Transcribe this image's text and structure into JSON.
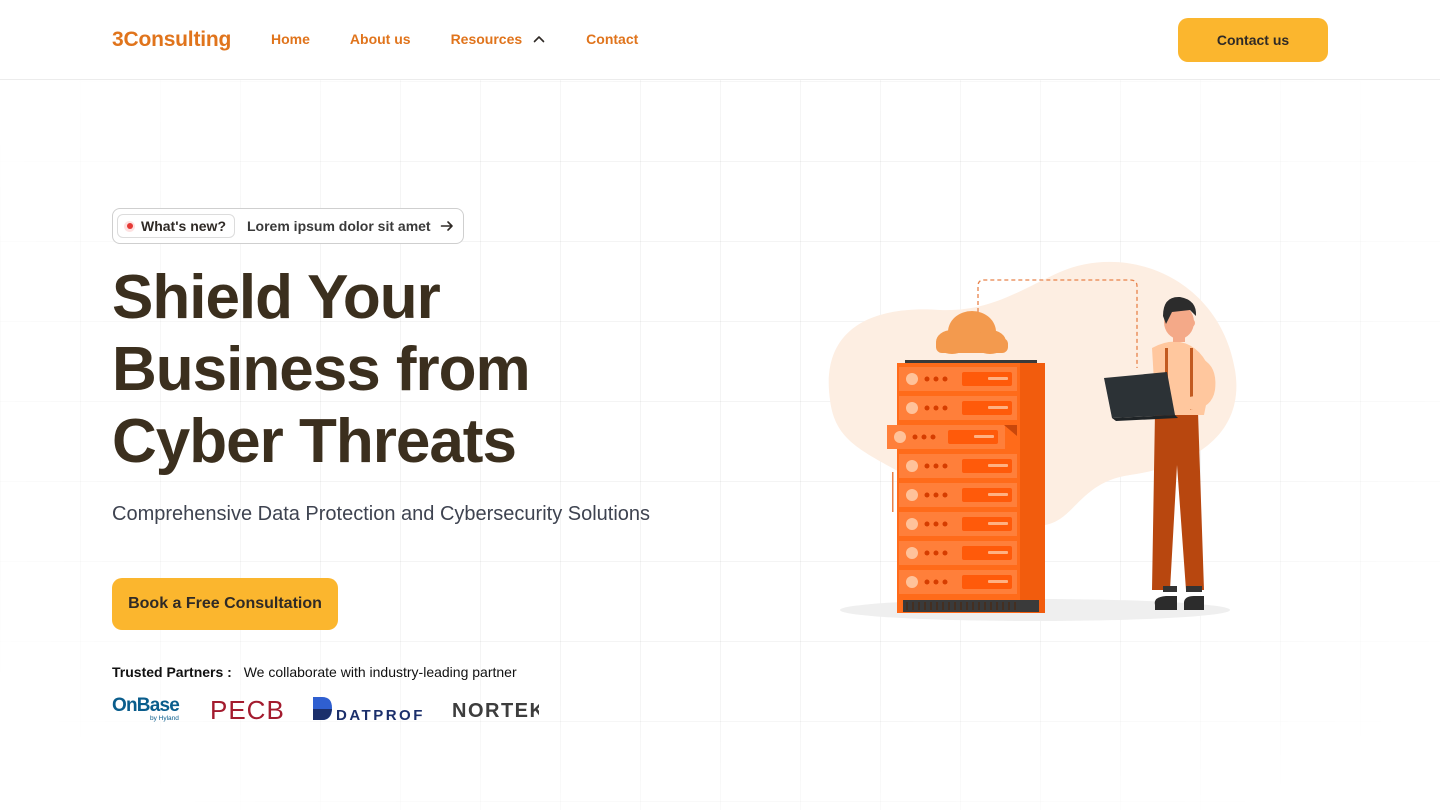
{
  "header": {
    "logo": "3Consulting",
    "nav": [
      {
        "label": "Home"
      },
      {
        "label": "About us"
      },
      {
        "label": "Resources",
        "icon": "chevron-up-icon"
      },
      {
        "label": "Contact"
      }
    ],
    "cta_label": "Contact us"
  },
  "hero": {
    "badge": {
      "label": "What's new?",
      "text": "Lorem ipsum dolor sit amet",
      "icon": "arrow-right-icon"
    },
    "title_lines": [
      "Shield Your",
      "Business from",
      "Cyber Threats"
    ],
    "subtitle": "Comprehensive Data Protection and Cybersecurity Solutions",
    "cta_label": "Book a Free Consultation"
  },
  "partners": {
    "label": "Trusted Partners :",
    "text": "We collaborate with industry-leading partner",
    "logos": [
      {
        "name": "OnBase",
        "sub": "by Hyland"
      },
      {
        "name": "PECB"
      },
      {
        "name": "DATPROF"
      },
      {
        "name": "NORTEK"
      }
    ]
  },
  "colors": {
    "brand_orange": "#e0741c",
    "accent_yellow": "#fbb62e",
    "heading": "#3b2f1e",
    "server_orange": "#ff6b1a"
  }
}
